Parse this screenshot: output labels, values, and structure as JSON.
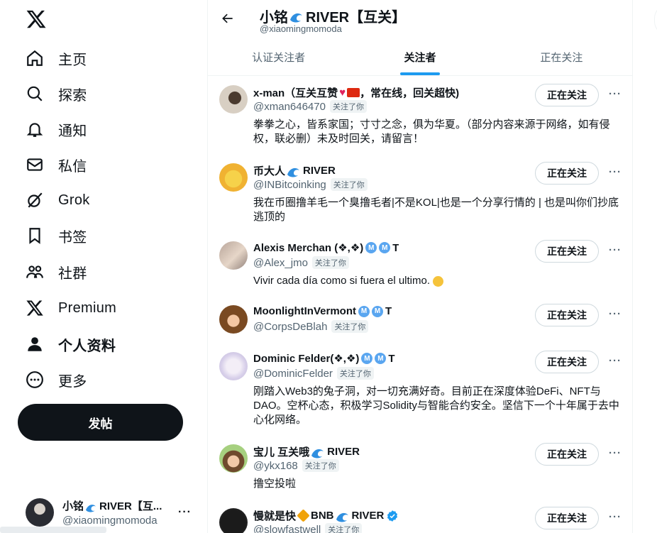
{
  "sidebar": {
    "items": [
      {
        "label": "主页",
        "icon": "home-icon"
      },
      {
        "label": "探索",
        "icon": "search-icon"
      },
      {
        "label": "通知",
        "icon": "bell-icon"
      },
      {
        "label": "私信",
        "icon": "mail-icon"
      },
      {
        "label": "Grok",
        "icon": "grok-icon"
      },
      {
        "label": "书签",
        "icon": "bookmark-icon"
      },
      {
        "label": "社群",
        "icon": "communities-icon"
      },
      {
        "label": "Premium",
        "icon": "x-logo-icon"
      },
      {
        "label": "个人资料",
        "icon": "person-icon"
      },
      {
        "label": "更多",
        "icon": "more-circle-icon"
      }
    ],
    "active_index": 8,
    "post_label": "发帖",
    "account": {
      "name": "小铭",
      "name_suffix": "RIVER【互...",
      "handle": "@xiaomingmomoda",
      "more": "···"
    }
  },
  "header": {
    "name": "小铭",
    "name_suffix": "RIVER【互关】",
    "handle": "@xiaomingmomoda"
  },
  "tabs": [
    {
      "label": "认证关注者"
    },
    {
      "label": "关注者"
    },
    {
      "label": "正在关注"
    }
  ],
  "active_tab": 1,
  "followers": [
    {
      "name_pre": "x-man（互关互赞",
      "name_post": "，常在线，回关超快)",
      "handle": "@xman646470",
      "badge": "关注了你",
      "bio": "拳拳之心，皆系家国；寸寸之念，俱为华夏。（部分内容来源于网络，如有侵权，联必删）未及时回关，请留言！",
      "button": "正在关注"
    },
    {
      "name_pre": "币大人",
      "name_post": "RIVER",
      "handle": "@INBitcoinking",
      "badge": "关注了你",
      "bio": "我在币圈撸羊毛一个臭撸毛者|不是KOL|也是一个分享行情的 | 也是叫你们抄底逃顶的",
      "button": "正在关注"
    },
    {
      "name_pre": "Alexis Merchan (❖,❖)",
      "name_post": "T",
      "handle": "@Alex_jmo",
      "badge": "关注了你",
      "bio": "Vivir cada día como si fuera el ultimo.",
      "button": "正在关注"
    },
    {
      "name_pre": "MoonlightInVermont",
      "name_post": "T",
      "handle": "@CorpsDeBlah",
      "badge": "关注了你",
      "bio": "",
      "button": "正在关注"
    },
    {
      "name_pre": "Dominic Felder(❖,❖)",
      "name_post": "T",
      "handle": "@DominicFelder",
      "badge": "关注了你",
      "bio": "刚踏入Web3的兔子洞，对一切充满好奇。目前正在深度体验DeFi、NFT与DAO。空杯心态，积极学习Solidity与智能合约安全。坚信下一个十年属于去中心化网络。",
      "button": "正在关注"
    },
    {
      "name_pre": "宝儿 互关哦",
      "name_post": "RIVER",
      "handle": "@ykx168",
      "badge": "关注了你",
      "bio": "撸空投啦",
      "button": "正在关注"
    },
    {
      "name_pre": "慢就是快",
      "name_mid": "BNB",
      "name_post": "RIVER",
      "handle": "@slowfastwell",
      "badge": "关注了你",
      "bio": "",
      "button": "正在关注"
    }
  ],
  "row_more": "···",
  "colors": {
    "accent": "#1d9bf0",
    "text": "#0f1419",
    "secondary": "#536471",
    "border": "#eff3f4",
    "post_button": "#0f1419"
  }
}
